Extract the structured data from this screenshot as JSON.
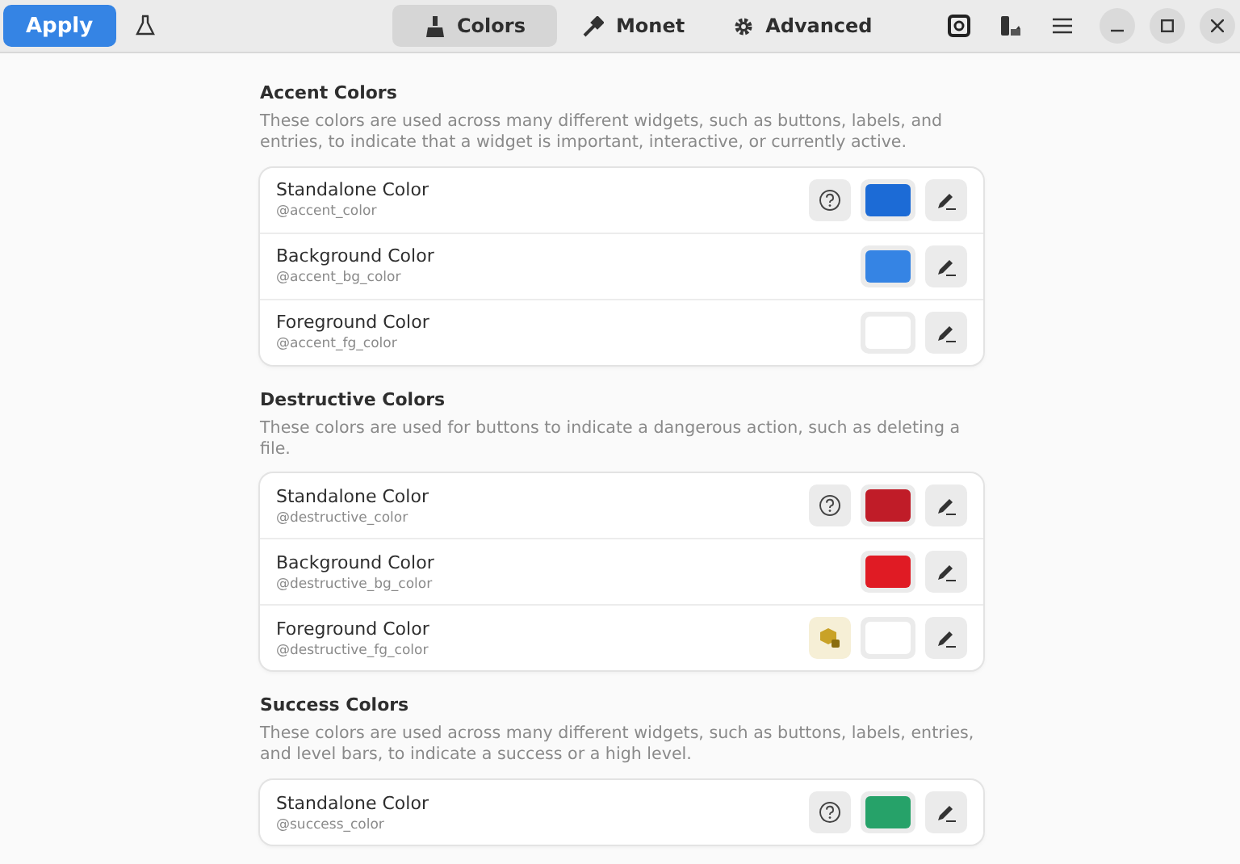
{
  "header": {
    "apply": "Apply",
    "tabs": [
      {
        "label": "Colors",
        "selected": true
      },
      {
        "label": "Monet",
        "selected": false
      },
      {
        "label": "Advanced",
        "selected": false
      }
    ]
  },
  "sections": [
    {
      "title": "Accent Colors",
      "description": "These colors are used across many different widgets, such as buttons, labels, and entries, to indicate that a widget is important, interactive, or currently active.",
      "rows": [
        {
          "name": "Standalone Color",
          "variable": "@accent_color",
          "kind": "help",
          "color": "#1c6bd6"
        },
        {
          "name": "Background Color",
          "variable": "@accent_bg_color",
          "kind": "plain",
          "color": "#3584e4"
        },
        {
          "name": "Foreground Color",
          "variable": "@accent_fg_color",
          "kind": "plain",
          "color": "#ffffff"
        }
      ]
    },
    {
      "title": "Destructive Colors",
      "description": "These colors are used for buttons to indicate a dangerous action, such as deleting a file.",
      "rows": [
        {
          "name": "Standalone Color",
          "variable": "@destructive_color",
          "kind": "help",
          "color": "#c01c28"
        },
        {
          "name": "Background Color",
          "variable": "@destructive_bg_color",
          "kind": "plain",
          "color": "#e01b24"
        },
        {
          "name": "Foreground Color",
          "variable": "@destructive_fg_color",
          "kind": "warning",
          "color": "#ffffff"
        }
      ]
    },
    {
      "title": "Success Colors",
      "description": "These colors are used across many different widgets, such as buttons, labels, entries, and level bars, to indicate a success or a high level.",
      "rows": [
        {
          "name": "Standalone Color",
          "variable": "@success_color",
          "kind": "help",
          "color": "#26a269"
        }
      ]
    }
  ]
}
